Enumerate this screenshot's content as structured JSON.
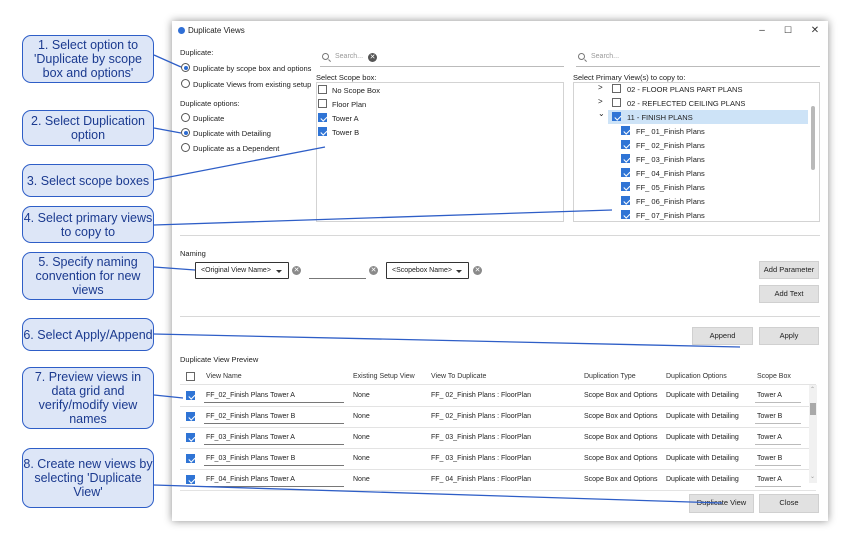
{
  "window": {
    "title": "Duplicate Views",
    "minimize": "–",
    "maximize": "☐",
    "close": "✕"
  },
  "duplicate": {
    "label": "Duplicate:",
    "options": [
      "Duplicate by scope box and options",
      "Duplicate Views from existing setup"
    ],
    "selected": 0
  },
  "duplicate_options": {
    "label": "Duplicate options:",
    "options": [
      "Duplicate",
      "Duplicate with Detailing",
      "Duplicate as a Dependent"
    ],
    "selected": 1
  },
  "scope": {
    "search_placeholder": "Search...",
    "label": "Select Scope box:",
    "items": [
      {
        "label": "No Scope Box",
        "checked": false
      },
      {
        "label": "Floor Plan",
        "checked": false
      },
      {
        "label": "Tower A",
        "checked": true
      },
      {
        "label": "Tower B",
        "checked": true
      }
    ]
  },
  "primary": {
    "search_placeholder": "Search...",
    "label": "Select Primary View(s) to copy to:",
    "groups": [
      {
        "label": "02 - FLOOR PLANS PART PLANS",
        "expander": ">",
        "checked": false
      },
      {
        "label": "02 - REFLECTED CEILING PLANS",
        "expander": ">",
        "checked": false
      },
      {
        "label": "11 - FINISH PLANS",
        "expander": "⌄",
        "checked": true
      }
    ],
    "children": [
      "FF_ 01_Finish Plans",
      "FF_ 02_Finish Plans",
      "FF_ 03_Finish Plans",
      "FF_ 04_Finish Plans",
      "FF_ 05_Finish Plans",
      "FF_ 06_Finish Plans",
      "FF_ 07_Finish Plans"
    ]
  },
  "naming": {
    "label": "Naming",
    "dropdown1": "<Original View Name>",
    "text_value": "",
    "dropdown2": "<Scopebox Name>",
    "x_glyph": "✕",
    "add_parameter": "Add Parameter",
    "add_text": "Add Text"
  },
  "actions": {
    "append": "Append",
    "apply": "Apply",
    "duplicate_view": "Duplicate View",
    "close": "Close"
  },
  "preview": {
    "label": "Duplicate View Preview",
    "columns": [
      "View Name",
      "Existing Setup View",
      "View To Duplicate",
      "Duplication Type",
      "Duplication Options",
      "Scope Box"
    ],
    "rows": [
      [
        "FF_02_Finish Plans Tower A",
        "None",
        "FF_ 02_Finish Plans : FloorPlan",
        "Scope Box and Options",
        "Duplicate with Detailing",
        "Tower A"
      ],
      [
        "FF_02_Finish Plans Tower B",
        "None",
        "FF_ 02_Finish Plans : FloorPlan",
        "Scope Box and Options",
        "Duplicate with Detailing",
        "Tower B"
      ],
      [
        "FF_03_Finish Plans Tower A",
        "None",
        "FF_ 03_Finish Plans : FloorPlan",
        "Scope Box and Options",
        "Duplicate with Detailing",
        "Tower A"
      ],
      [
        "FF_03_Finish Plans Tower B",
        "None",
        "FF_ 03_Finish Plans : FloorPlan",
        "Scope Box and Options",
        "Duplicate with Detailing",
        "Tower B"
      ],
      [
        "FF_04_Finish Plans Tower A",
        "None",
        "FF_ 04_Finish Plans : FloorPlan",
        "Scope Box and Options",
        "Duplicate with Detailing",
        "Tower A"
      ]
    ]
  },
  "callouts": [
    "1. Select option to 'Duplicate by scope box and options'",
    "2. Select Duplication option",
    "3. Select scope boxes",
    "4. Select primary views to copy to",
    "5. Specify naming convention for new views",
    "6. Select Apply/Append",
    "7. Preview views in data grid and verify/modify view names",
    "8. Create new views by selecting 'Duplicate View'"
  ],
  "colors": {
    "accent": "#2f74d5",
    "callout_border": "#2e5ec7",
    "callout_fill": "#dde6f7",
    "selection": "#cde3f7"
  }
}
